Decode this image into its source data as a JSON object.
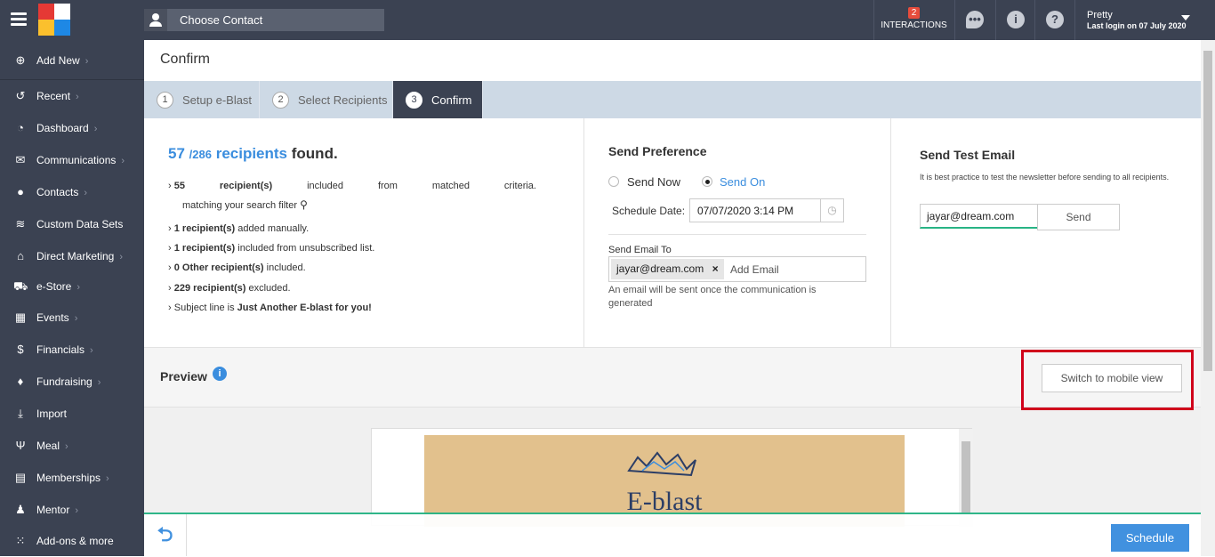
{
  "topbar": {
    "contact_label": "Choose Contact",
    "interactions_count": "2",
    "interactions_label": "INTERACTIONS",
    "user_name": "Pretty",
    "last_login": "Last login on 07 July 2020"
  },
  "sidebar": {
    "items": [
      {
        "label": "Add New",
        "icon": "plus-circle-icon"
      },
      {
        "label": "Recent",
        "icon": "history-icon"
      },
      {
        "label": "Dashboard",
        "icon": "gauge-icon"
      },
      {
        "label": "Communications",
        "icon": "envelope-icon"
      },
      {
        "label": "Contacts",
        "icon": "user-icon"
      },
      {
        "label": "Custom Data Sets",
        "icon": "layers-icon"
      },
      {
        "label": "Direct Marketing",
        "icon": "home-icon"
      },
      {
        "label": "e-Store",
        "icon": "cart-icon"
      },
      {
        "label": "Events",
        "icon": "calendar-icon"
      },
      {
        "label": "Financials",
        "icon": "money-icon"
      },
      {
        "label": "Fundraising",
        "icon": "moneybag-icon"
      },
      {
        "label": "Import",
        "icon": "download-icon"
      },
      {
        "label": "Meal",
        "icon": "utensils-icon"
      },
      {
        "label": "Memberships",
        "icon": "id-card-icon"
      },
      {
        "label": "Mentor",
        "icon": "mentor-icon"
      },
      {
        "label": "Add-ons & more",
        "icon": "grid-icon"
      }
    ]
  },
  "page": {
    "title": "Confirm",
    "steps": [
      {
        "num": "1",
        "label": "Setup e-Blast"
      },
      {
        "num": "2",
        "label": "Select Recipients"
      },
      {
        "num": "3",
        "label": "Confirm"
      }
    ]
  },
  "summary": {
    "count": "57",
    "total": "/286",
    "recipients_word": "recipients",
    "found_word": "found.",
    "line1_num": "55",
    "line1_a": "recipient(s)",
    "line1_b": "included",
    "line1_c": "from",
    "line1_d": "matched",
    "line1_e": "criteria.",
    "line1_f": "matching your search filter",
    "line2_bold": "1 recipient(s)",
    "line2_rest": " added manually.",
    "line3_bold": "1 recipient(s)",
    "line3_rest": " included from unsubscribed list.",
    "line4_bold": "0 Other recipient(s)",
    "line4_rest": " included.",
    "line5_bold": "229 recipient(s)",
    "line5_rest": " excluded.",
    "line6_pre": "Subject line is ",
    "line6_bold": "Just Another E-blast for you!"
  },
  "send_pref": {
    "title": "Send Preference",
    "send_now": "Send Now",
    "send_on": "Send On",
    "schedule_label": "Schedule Date:",
    "schedule_value": "07/07/2020 3:14 PM",
    "send_to_label": "Send Email To",
    "email_tag": "jayar@dream.com",
    "add_email_placeholder": "Add Email",
    "note": "An email will be sent once the communication is generated"
  },
  "test_email": {
    "title": "Send Test Email",
    "hint": "It is best practice to test the newsletter before sending to all recipients.",
    "value": "jayar@dream.com",
    "send_label": "Send"
  },
  "preview": {
    "title": "Preview",
    "switch_label": "Switch to mobile view",
    "banner_text": "E-blast"
  },
  "footer": {
    "schedule_label": "Schedule"
  }
}
